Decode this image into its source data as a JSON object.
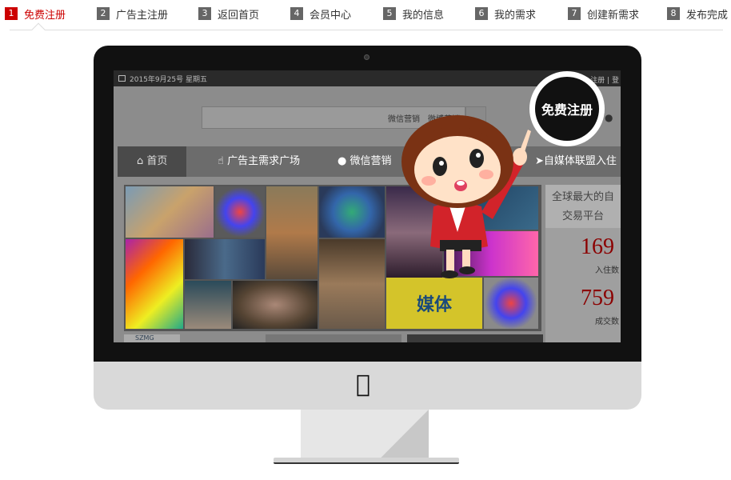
{
  "steps": [
    {
      "num": "1",
      "label": "免费注册",
      "active": true
    },
    {
      "num": "2",
      "label": "广告主注册"
    },
    {
      "num": "3",
      "label": "返回首页"
    },
    {
      "num": "4",
      "label": "会员中心"
    },
    {
      "num": "5",
      "label": "我的信息"
    },
    {
      "num": "6",
      "label": "我的需求"
    },
    {
      "num": "7",
      "label": "创建新需求"
    },
    {
      "num": "8",
      "label": "发布完成"
    }
  ],
  "screen": {
    "date": "2015年9月25号 星期五",
    "top_right": "注册 | 登",
    "search_tags": [
      "微信营销",
      "微博营销"
    ],
    "nav": {
      "home": "首页",
      "ad_square": "广告主需求广场",
      "wechat": "微信营销",
      "media_union": "自媒体联盟入住"
    },
    "sidebar": {
      "headline_1": "全球最大的自",
      "headline_2": "交易平台",
      "stat1_value": "169",
      "stat1_label": "入住数",
      "stat2_value": "759",
      "stat2_label": "成交数"
    },
    "gallery_text": "媒体",
    "footer_logo": "SZMG"
  },
  "bubble": {
    "label": "免费注册"
  },
  "colors": {
    "accent": "#cc0000",
    "bezel": "#111111",
    "chin": "#d9d9d9"
  }
}
